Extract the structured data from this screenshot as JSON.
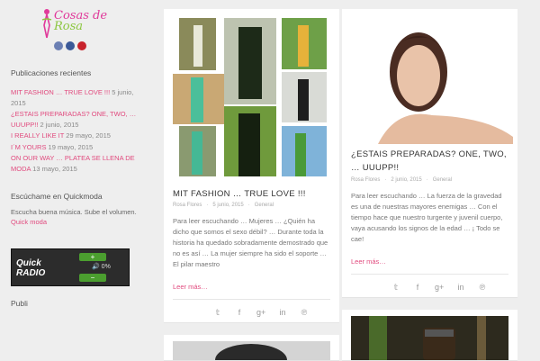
{
  "site": {
    "logo_line1": "Cosas de",
    "logo_line2": "Rosa"
  },
  "social": [
    "rss-icon",
    "facebook-icon",
    "pinterest-icon"
  ],
  "recent": {
    "title": "Publicaciones recientes",
    "items": [
      {
        "link": "MIT FASHION … TRUE LOVE !!!",
        "date": " 5 junio, 2015"
      },
      {
        "link": "¿ESTAIS PREPARADAS? ONE, TWO, … UUUPP!!",
        "date": " 2 junio, 2015"
      },
      {
        "link": "I REALLY LIKE IT",
        "date": " 29 mayo, 2015"
      },
      {
        "link": "I´M YOURS",
        "date": " 19 mayo, 2015"
      },
      {
        "link": "ON OUR WAY … PLATEA SE LLENA DE MODA",
        "date": " 13 mayo, 2015"
      }
    ]
  },
  "quickmoda": {
    "title": "Escúchame en Quickmoda",
    "text": "Escucha buena música. Sube el volumen.",
    "link": "Quick moda",
    "radio_logo1": "Quick",
    "radio_logo2": "RADIO",
    "volume": "0%",
    "plus": "+",
    "minus": "−"
  },
  "publi": {
    "title": "Publi"
  },
  "posts": [
    {
      "title": "MIT FASHION … TRUE LOVE !!!",
      "author": "Rosa Flores",
      "date": "5 junio, 2015",
      "category": "General",
      "excerpt": "Para leer escuchando …    Mujeres … ¿Quién ha dicho que somos el sexo débil? … Durante toda la historia ha quedado sobradamente demostrado que no es así … La mujer siempre ha sido el soporte … El pilar maestro",
      "more": "Leer más…"
    },
    {
      "title": "¿ESTAIS PREPARADAS? ONE, TWO, … UUUPP!!",
      "author": "Rosa Flores",
      "date": "2 junio, 2015",
      "category": "General",
      "excerpt": "Para leer escuchando …      La fuerza de la gravedad es una de nuestras mayores enemigas … Con el tiempo hace que nuestro turgente y juvenil cuerpo, vaya acusando los signos de la edad … ¡ Todo se cae!",
      "more": "Leer más…"
    }
  ],
  "share_icons": [
    "twitter-icon",
    "facebook-icon",
    "google-plus-icon",
    "linkedin-icon",
    "pinterest-icon"
  ],
  "share_glyphs": [
    "𝕥",
    "f",
    "g+",
    "in",
    "℗"
  ],
  "colors": {
    "accent": "#e14a7e",
    "background": "#eeeeee"
  }
}
